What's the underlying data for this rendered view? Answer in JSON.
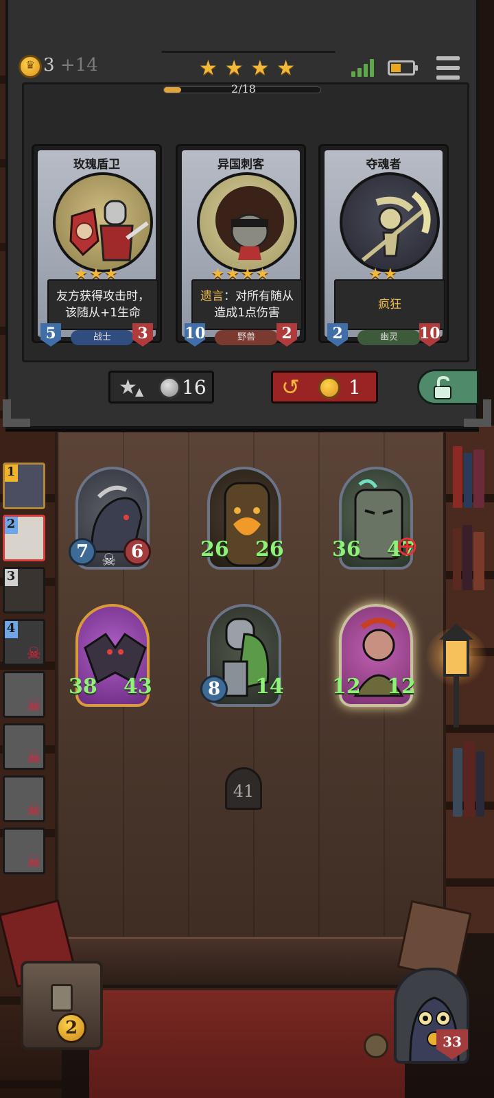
{
  "header": {
    "gold": "3",
    "gold_income": "+14",
    "tier_stars": 4,
    "progress_label": "2/18",
    "progress_fraction": 0.111
  },
  "shop": {
    "cards": [
      {
        "name": "玫瑰盾卫",
        "stars": 3,
        "desc": "友方获得攻击时，该随从+1生命",
        "tribe": "战士",
        "attack": "5",
        "health": "3"
      },
      {
        "name": "异国刺客",
        "stars": 4,
        "desc_prefix": "遗言",
        "desc": "：对所有随从造成1点伤害",
        "tribe": "野兽",
        "attack": "10",
        "health": "2"
      },
      {
        "name": "夺魂者",
        "stars": 2,
        "desc": "疯狂",
        "tribe": "幽灵",
        "attack": "2",
        "health": "10"
      }
    ],
    "upgrade_cost": "16",
    "reroll_cost": "1"
  },
  "history": [
    {
      "num": "1",
      "dead": false,
      "color": "#f0b32a"
    },
    {
      "num": "2",
      "dead": false,
      "color": "#6ea6e8"
    },
    {
      "num": "3",
      "dead": false,
      "color": "#d0d0d0"
    },
    {
      "num": "4",
      "dead": true,
      "color": "#6ea6e8"
    },
    {
      "num": "",
      "dead": true
    },
    {
      "num": "",
      "dead": true
    },
    {
      "num": "",
      "dead": true
    },
    {
      "num": "",
      "dead": true
    }
  ],
  "board": {
    "minions": [
      {
        "attack": "7",
        "health": "6",
        "buffed": false
      },
      {
        "attack": "26",
        "health": "26",
        "buffed": true
      },
      {
        "attack": "36",
        "health": "47",
        "buffed": true
      },
      {
        "attack": "38",
        "health": "43",
        "buffed": true
      },
      {
        "attack": "8",
        "health": "14",
        "buffed": true
      },
      {
        "attack": "12",
        "health": "12",
        "buffed": true
      }
    ],
    "door_counter": "41"
  },
  "footer": {
    "chest_count": "2",
    "hero_health": "33"
  },
  "colors": {
    "gold": "#f4b73a",
    "attack": "#3e6b96",
    "health": "#a33c3c",
    "buff": "#8ff07a",
    "reroll": "#9a2424",
    "freeze": "#4f8a6b"
  }
}
